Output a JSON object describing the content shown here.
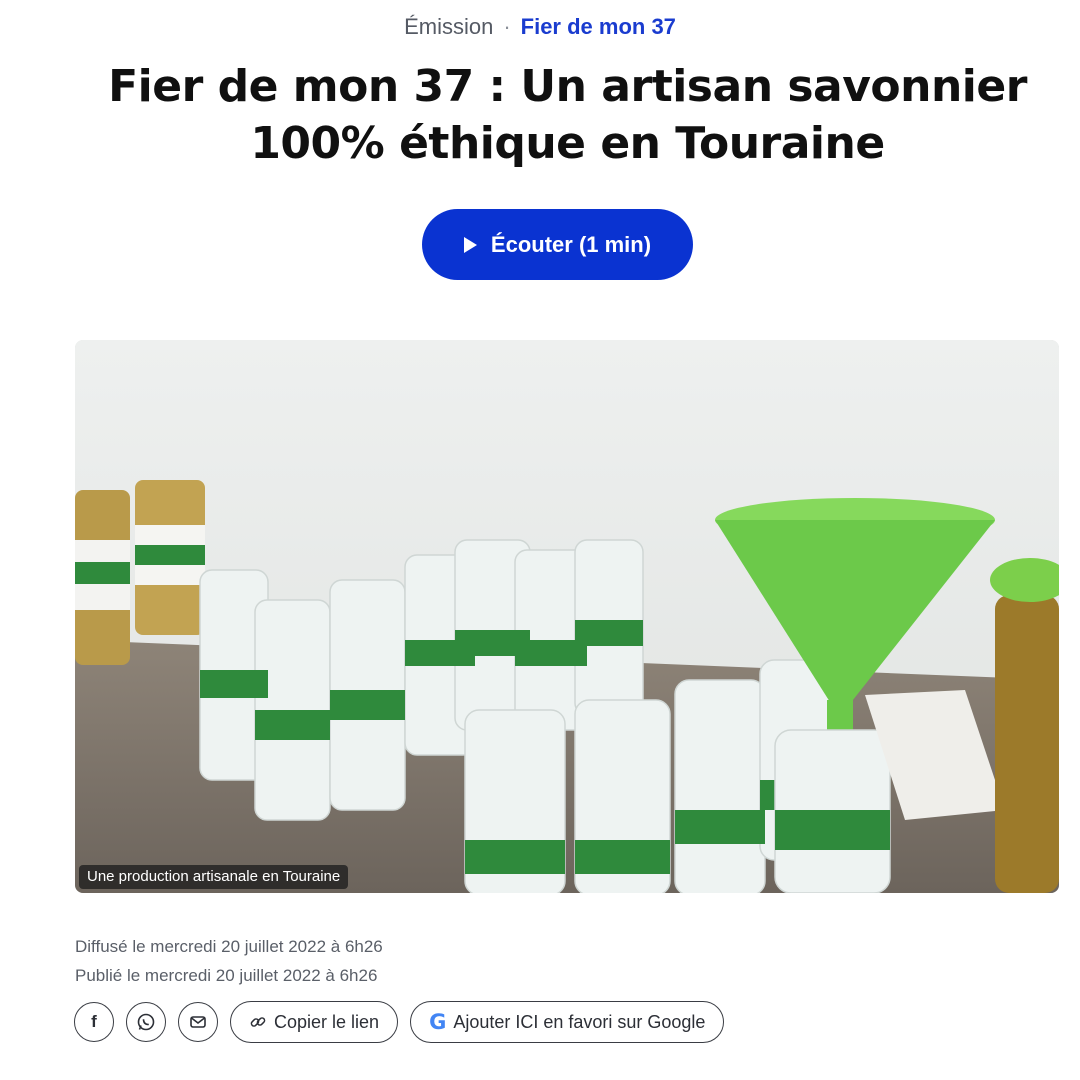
{
  "header": {
    "kicker_label": "Émission",
    "kicker_separator": "·",
    "kicker_link": "Fier de mon 37",
    "title": "Fier de mon 37 : Un artisan savonnier 100% éthique en Touraine"
  },
  "listen_button": {
    "label": "Écouter (1 min)",
    "icon": "play-icon"
  },
  "media": {
    "caption": "Une production artisanale en Touraine",
    "colors": {
      "label_green": "#2f8a3c",
      "funnel_green": "#7ed957"
    }
  },
  "meta": {
    "broadcast": "Diffusé le mercredi 20 juillet 2022 à 6h26",
    "published": "Publié le mercredi 20 juillet 2022 à 6h26"
  },
  "share": {
    "facebook_icon": "f",
    "whatsapp_icon": "whatsapp-icon",
    "email_icon": "mail-icon",
    "copy_link_label": "Copier le lien",
    "google_label": "Ajouter ICI en favori sur Google"
  },
  "colors": {
    "accent": "#0a33d1",
    "link": "#1a3ccf",
    "meta_text": "#5a5f68"
  }
}
